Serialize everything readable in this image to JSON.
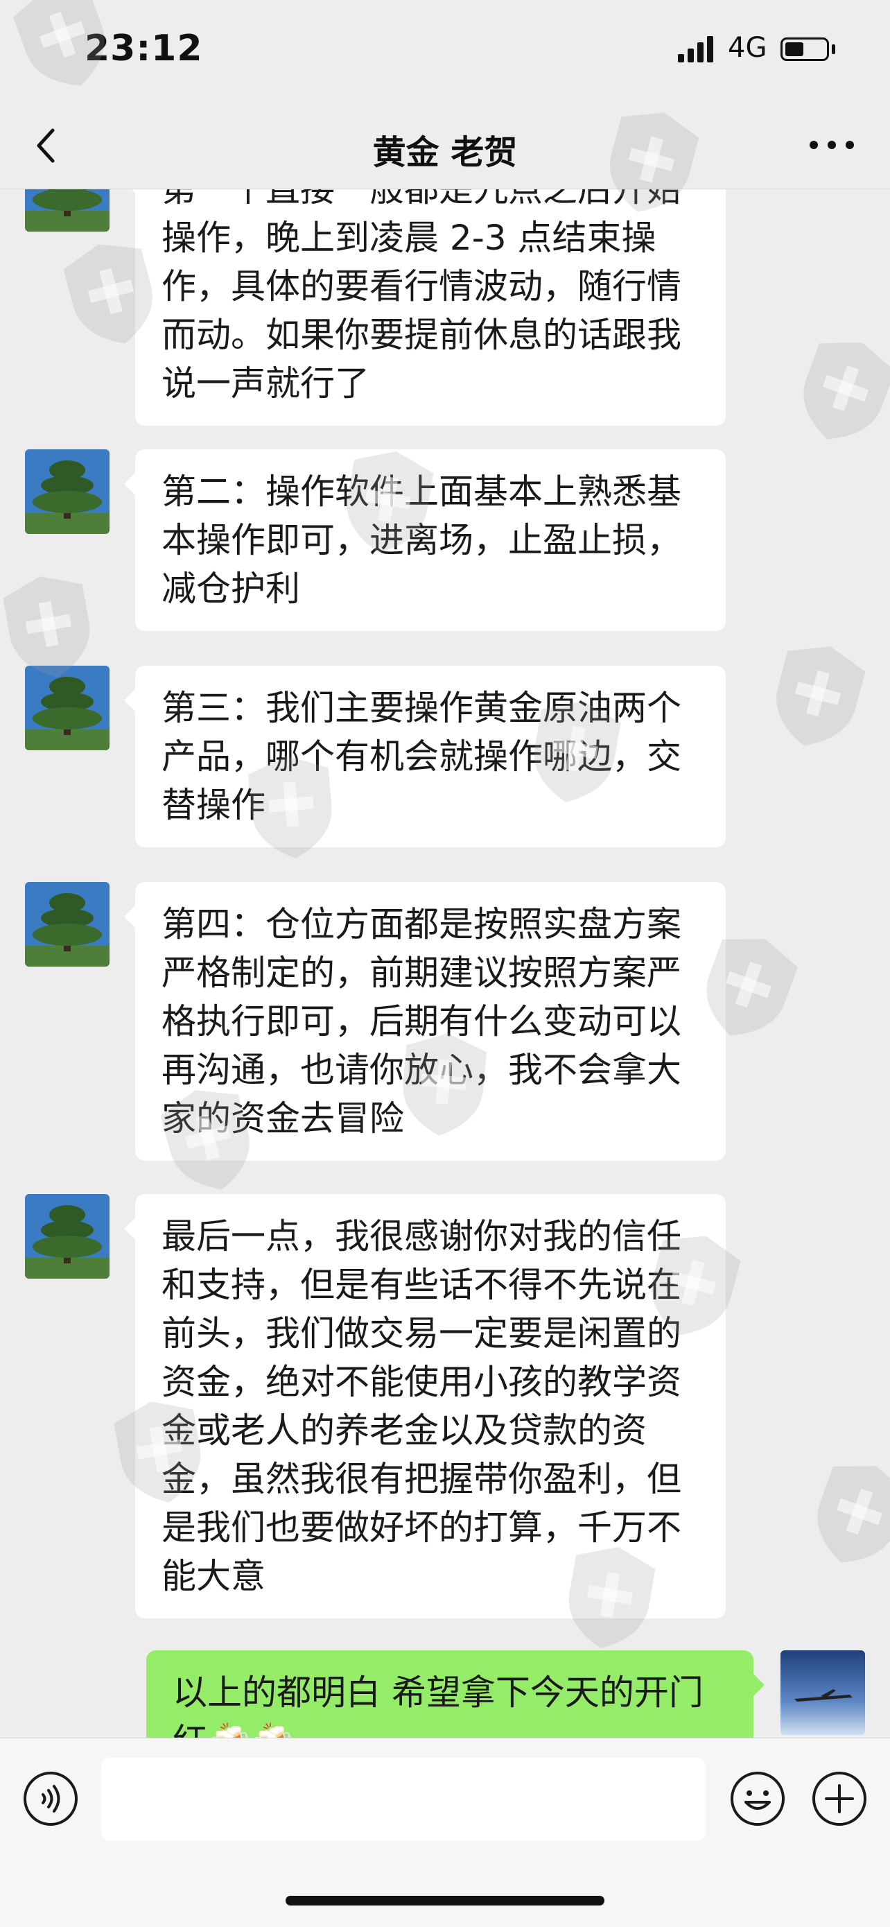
{
  "status_bar": {
    "time": "23:12",
    "network": "4G",
    "signal_icon": "signal-bars-icon",
    "battery_icon": "battery-icon"
  },
  "header": {
    "title": "黄金 老贺",
    "back_icon": "chevron-left-icon",
    "more_icon": "ellipsis-icon"
  },
  "messages": [
    {
      "sender": "contact",
      "text": "第一个直接一般都是九点之后开始操作，晚上到凌晨 2-3 点结束操作，具体的要看行情波动，随行情而动。如果你要提前休息的话跟我说一声就行了"
    },
    {
      "sender": "contact",
      "text": "第二：操作软件上面基本上熟悉基本操作即可，进离场，止盈止损，减仓护利"
    },
    {
      "sender": "contact",
      "text": "第三：我们主要操作黄金原油两个产品，哪个有机会就操作哪边，交替操作"
    },
    {
      "sender": "contact",
      "text": "第四：仓位方面都是按照实盘方案严格制定的，前期建议按照方案严格执行即可，后期有什么变动可以再沟通，也请你放心，我不会拿大家的资金去冒险"
    },
    {
      "sender": "contact",
      "text": "最后一点，我很感谢你对我的信任和支持，但是有些话不得不先说在前头，我们做交易一定要是闲置的资金，绝对不能使用小孩的教学资金或老人的养老金以及贷款的资金，虽然我很有把握带你盈利，但是我们也要做好坏的打算，千万不能大意"
    },
    {
      "sender": "me",
      "text": "以上的都明白  希望拿下今天的开门红🍻🍻"
    }
  ],
  "input_bar": {
    "voice_icon": "voice-icon",
    "emoji_icon": "emoji-icon",
    "plus_icon": "plus-circle-icon",
    "placeholder": ""
  },
  "colors": {
    "background": "#ededed",
    "bubble_contact": "#ffffff",
    "bubble_me": "#95ec69"
  }
}
